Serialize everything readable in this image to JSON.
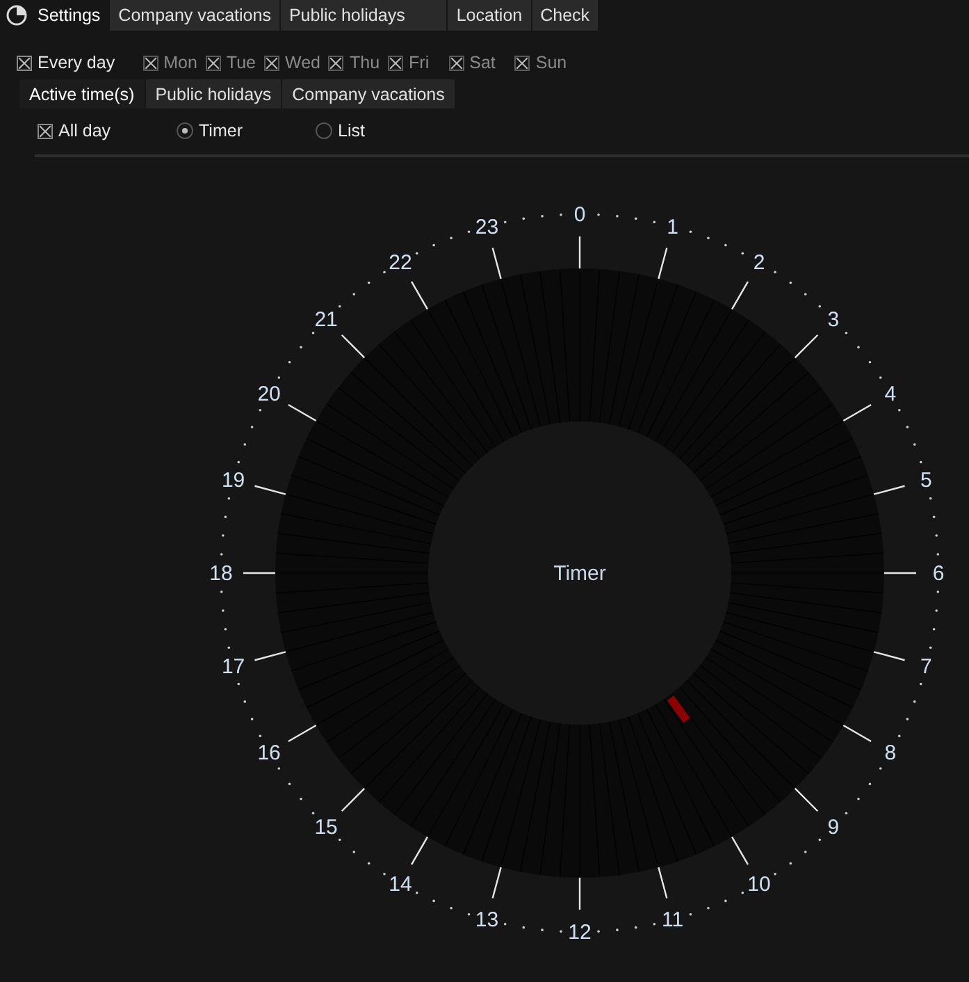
{
  "tabs": [
    {
      "label": "Settings",
      "selected": true
    },
    {
      "label": "Company vacations",
      "selected": false
    },
    {
      "label": "Public holidays",
      "selected": false
    },
    {
      "label": "Location",
      "selected": false
    },
    {
      "label": "Check",
      "selected": false
    }
  ],
  "days": [
    {
      "label": "Every day",
      "checked": true,
      "disabled": false
    },
    {
      "label": "Mon",
      "checked": true,
      "disabled": true
    },
    {
      "label": "Tue",
      "checked": true,
      "disabled": true
    },
    {
      "label": "Wed",
      "checked": true,
      "disabled": true
    },
    {
      "label": "Thu",
      "checked": true,
      "disabled": true
    },
    {
      "label": "Fri",
      "checked": true,
      "disabled": true
    },
    {
      "label": "Sat",
      "checked": true,
      "disabled": true
    },
    {
      "label": "Sun",
      "checked": true,
      "disabled": true
    }
  ],
  "subtabs": [
    {
      "label": "Active time(s)",
      "selected": true
    },
    {
      "label": "Public holidays",
      "selected": false
    },
    {
      "label": "Company vacations",
      "selected": false
    }
  ],
  "options": [
    {
      "kind": "checkbox",
      "label": "All day",
      "selected": true
    },
    {
      "kind": "radio",
      "label": "Timer",
      "selected": true
    },
    {
      "kind": "radio",
      "label": "List",
      "selected": false
    }
  ],
  "dial": {
    "center_label": "Timer",
    "hours": [
      "0",
      "1",
      "2",
      "3",
      "4",
      "5",
      "6",
      "7",
      "8",
      "9",
      "10",
      "11",
      "12",
      "13",
      "14",
      "15",
      "16",
      "17",
      "18",
      "19",
      "20",
      "21",
      "22",
      "23"
    ]
  }
}
